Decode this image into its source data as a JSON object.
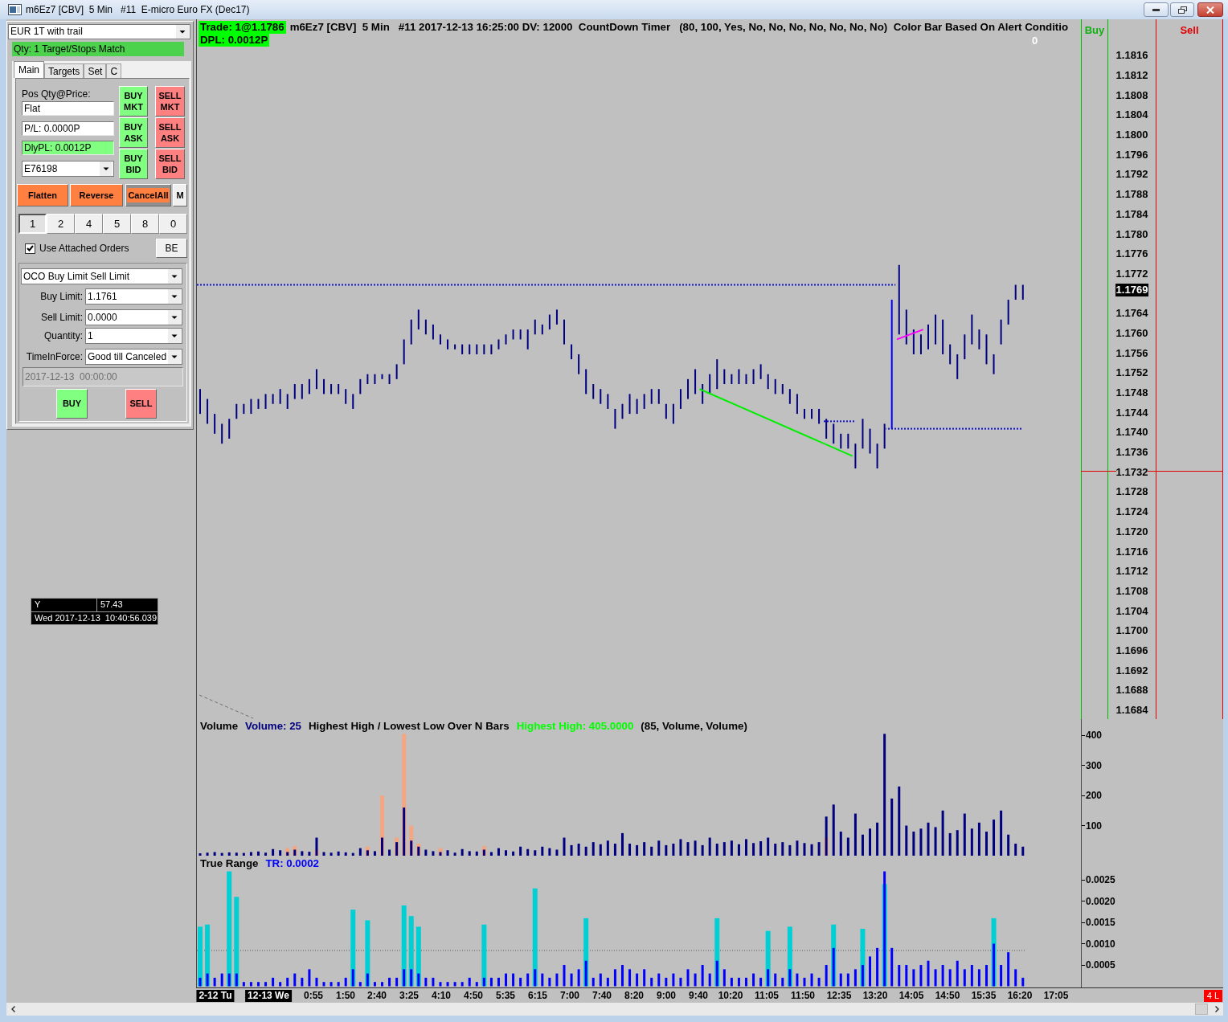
{
  "window": {
    "title": "m6Ez7 [CBV]  5 Min   #11  E-micro Euro FX (Dec17)"
  },
  "chart_trader": {
    "atm_strategy": "EUR 1T with trail",
    "status": "Qty: 1 Target/Stops Match",
    "tabs": [
      {
        "label": "Main",
        "selected": true
      },
      {
        "label": "Targets",
        "selected": false
      },
      {
        "label": "Set",
        "selected": false
      },
      {
        "label": "C",
        "selected": false
      }
    ],
    "position_label": "Pos Qty@Price:",
    "position": "Flat",
    "pnl": "P/L: 0.0000P",
    "daily_pnl": "DlyPL: 0.0012P",
    "account": "E76198",
    "order_buttons": [
      {
        "label": "BUY MKT",
        "kind": "buy"
      },
      {
        "label": "SELL MKT",
        "kind": "sell"
      },
      {
        "label": "BUY ASK",
        "kind": "buy"
      },
      {
        "label": "SELL ASK",
        "kind": "sell"
      },
      {
        "label": "BUY BID",
        "kind": "buy"
      },
      {
        "label": "SELL BID",
        "kind": "sell"
      }
    ],
    "action_buttons": [
      {
        "label": "Flatten",
        "kind": "accent"
      },
      {
        "label": "Reverse",
        "kind": "accent"
      },
      {
        "label": "CancelAll",
        "kind": "cancel"
      },
      {
        "label": "M",
        "kind": "plain"
      }
    ],
    "quantity_buttons": [
      {
        "label": "1",
        "selected": true
      },
      {
        "label": "2",
        "selected": false
      },
      {
        "label": "4",
        "selected": false
      },
      {
        "label": "5",
        "selected": false
      },
      {
        "label": "8",
        "selected": false
      },
      {
        "label": "0",
        "selected": false
      }
    ],
    "use_attached_orders": {
      "label": "Use Attached Orders",
      "checked": true
    },
    "be_button": "BE",
    "order_form": {
      "order_type": "OCO Buy Limit Sell Limit",
      "fields": [
        {
          "label": "Buy Limit:",
          "value": "1.1761"
        },
        {
          "label": "Sell Limit:",
          "value": "0.0000"
        },
        {
          "label": "Quantity:",
          "value": "1"
        },
        {
          "label": "TimeInForce:",
          "value": "Good till Canceled"
        }
      ],
      "expiry": {
        "value": "2017-12-13  00:00:00",
        "disabled": true
      },
      "buttons": [
        {
          "label": "BUY",
          "kind": "buy"
        },
        {
          "label": "SELL",
          "kind": "sell"
        }
      ]
    }
  },
  "data_box": {
    "rows": [
      {
        "cells": [
          "Y",
          "57.43"
        ]
      },
      {
        "cells": [
          "Wed 2017-12-13  10:40:56.039"
        ]
      }
    ]
  },
  "price_panel": {
    "legend": [
      {
        "segments": [
          {
            "text": "Trade: 1@1.1786",
            "kind": "highlight"
          },
          {
            "text": "m6Ez7 [CBV]  5 Min   #11 2017-12-13 16:25:00 DV: 12000  CountDown Timer   (80, 100, Yes, No, No, No, No, No, No, No)  Color Bar Based On Alert Conditio",
            "kind": "plain"
          }
        ]
      },
      {
        "segments": [
          {
            "text": "DPL: 0.0012P",
            "kind": "highlight"
          }
        ]
      }
    ],
    "countdown": "0",
    "buy_column": "Buy",
    "sell_column": "Sell",
    "price_axis": [
      {
        "text": "1.1816",
        "kind": "tick"
      },
      {
        "text": "1.1812",
        "kind": "tick"
      },
      {
        "text": "1.1808",
        "kind": "tick"
      },
      {
        "text": "1.1804",
        "kind": "tick"
      },
      {
        "text": "1.1800",
        "kind": "tick"
      },
      {
        "text": "1.1796",
        "kind": "tick"
      },
      {
        "text": "1.1792",
        "kind": "tick"
      },
      {
        "text": "1.1788",
        "kind": "tick"
      },
      {
        "text": "1.1784",
        "kind": "tick"
      },
      {
        "text": "1.1780",
        "kind": "tick"
      },
      {
        "text": "1.1776",
        "kind": "tick"
      },
      {
        "text": "1.1772",
        "kind": "tick"
      },
      {
        "text": "1.1769",
        "kind": "last_price"
      },
      {
        "text": "1.1764",
        "kind": "tick"
      },
      {
        "text": "1.1760",
        "kind": "tick"
      },
      {
        "text": "1.1756",
        "kind": "tick"
      },
      {
        "text": "1.1752",
        "kind": "tick"
      },
      {
        "text": "1.1748",
        "kind": "tick"
      },
      {
        "text": "1.1744",
        "kind": "tick"
      },
      {
        "text": "1.1740",
        "kind": "tick"
      },
      {
        "text": "1.1736",
        "kind": "tick"
      },
      {
        "text": "1.1732",
        "kind": "tick"
      },
      {
        "text": "1.1728",
        "kind": "tick"
      },
      {
        "text": "1.1724",
        "kind": "tick"
      },
      {
        "text": "1.1720",
        "kind": "tick"
      },
      {
        "text": "1.1716",
        "kind": "tick"
      },
      {
        "text": "1.1712",
        "kind": "tick"
      },
      {
        "text": "1.1708",
        "kind": "tick"
      },
      {
        "text": "1.1704",
        "kind": "tick"
      },
      {
        "text": "1.1700",
        "kind": "tick"
      },
      {
        "text": "1.1696",
        "kind": "tick"
      },
      {
        "text": "1.1692",
        "kind": "tick"
      },
      {
        "text": "1.1688",
        "kind": "tick"
      },
      {
        "text": "1.1684",
        "kind": "tick"
      }
    ]
  },
  "volume_panel": {
    "legend": [
      {
        "text": "Volume",
        "color": "#000000"
      },
      {
        "text": "Volume: 25",
        "color": "#000080"
      },
      {
        "text": "Highest High / Lowest Low Over N Bars",
        "color": "#000000"
      },
      {
        "text": "Highest High: 405.0000",
        "color": "#00ff00"
      },
      {
        "text": "(85, Volume, Volume)",
        "color": "#000000"
      }
    ],
    "axis_labels": [
      "400",
      "300",
      "200",
      "100"
    ]
  },
  "true_range_panel": {
    "legend": [
      {
        "text": "True Range",
        "color": "#000000"
      },
      {
        "text": "TR: 0.0002",
        "color": "#0000ff"
      }
    ],
    "axis_labels": [
      "0.0025",
      "0.0020",
      "0.0015",
      "0.0010",
      "0.0005"
    ]
  },
  "time_axis": {
    "labels": [
      {
        "text": "2-12 Tu",
        "kind": "date"
      },
      {
        "text": "12-13 We",
        "kind": "date"
      },
      {
        "text": "0:55",
        "kind": "time"
      },
      {
        "text": "1:50",
        "kind": "time"
      },
      {
        "text": "2:40",
        "kind": "time"
      },
      {
        "text": "3:25",
        "kind": "time"
      },
      {
        "text": "4:10",
        "kind": "time"
      },
      {
        "text": "4:50",
        "kind": "time"
      },
      {
        "text": "5:35",
        "kind": "time"
      },
      {
        "text": "6:15",
        "kind": "time"
      },
      {
        "text": "7:00",
        "kind": "time"
      },
      {
        "text": "7:40",
        "kind": "time"
      },
      {
        "text": "8:20",
        "kind": "time"
      },
      {
        "text": "9:00",
        "kind": "time"
      },
      {
        "text": "9:40",
        "kind": "time"
      },
      {
        "text": "10:20",
        "kind": "time"
      },
      {
        "text": "11:05",
        "kind": "time"
      },
      {
        "text": "11:50",
        "kind": "time"
      },
      {
        "text": "12:35",
        "kind": "time"
      },
      {
        "text": "13:20",
        "kind": "time"
      },
      {
        "text": "14:05",
        "kind": "time"
      },
      {
        "text": "14:50",
        "kind": "time"
      },
      {
        "text": "15:35",
        "kind": "time"
      },
      {
        "text": "16:20",
        "kind": "time"
      },
      {
        "text": "17:05",
        "kind": "time"
      }
    ],
    "status": "4 L"
  }
}
